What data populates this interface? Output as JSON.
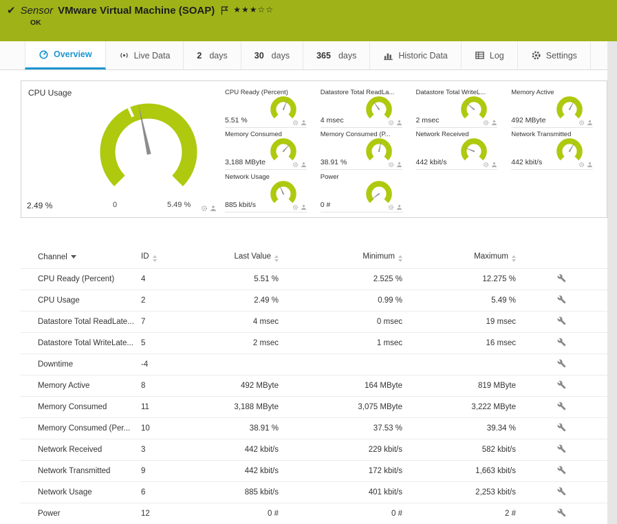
{
  "colors": {
    "brand_green": "#9fb318",
    "gauge_green": "#aec90e",
    "accent_blue": "#1c95d2"
  },
  "header": {
    "kind_label": "Sensor",
    "title": "VMware Virtual Machine (SOAP)",
    "status_text": "OK",
    "rating": {
      "filled": 3,
      "total": 5,
      "stars_text": "★★★☆☆"
    }
  },
  "tabs": {
    "overview": {
      "label": "Overview"
    },
    "live_data": {
      "label": "Live Data"
    },
    "days2": {
      "number": "2",
      "label": "days"
    },
    "days30": {
      "number": "30",
      "label": "days"
    },
    "days365": {
      "number": "365",
      "label": "days"
    },
    "historic": {
      "label": "Historic Data"
    },
    "log": {
      "label": "Log"
    },
    "settings": {
      "label": "Settings"
    }
  },
  "gauges": {
    "main": {
      "title": "CPU Usage",
      "value": "2.49 %",
      "min_label": "0",
      "max_label": "5.49 %",
      "needle_angle": -12
    },
    "small": [
      {
        "title": "CPU Ready (Percent)",
        "value": "5.51 %",
        "needle_angle": 22
      },
      {
        "title": "Datastore Total ReadLa...",
        "value": "4 msec",
        "needle_angle": -35
      },
      {
        "title": "Datastore Total WriteL...",
        "value": "2 msec",
        "needle_angle": -50
      },
      {
        "title": "Memory Active",
        "value": "492 MByte",
        "needle_angle": 28
      },
      {
        "title": "Memory Consumed",
        "value": "3,188 MByte",
        "needle_angle": 42
      },
      {
        "title": "Memory Consumed (P...",
        "value": "38.91 %",
        "needle_angle": 12
      },
      {
        "title": "Network Received",
        "value": "442 kbit/s",
        "needle_angle": -68
      },
      {
        "title": "Network Transmitted",
        "value": "442 kbit/s",
        "needle_angle": 30
      },
      {
        "title": "Network Usage",
        "value": "885 kbit/s",
        "needle_angle": -24
      },
      {
        "title": "Power",
        "value": "0 #",
        "needle_angle": -126
      }
    ]
  },
  "table": {
    "headers": {
      "channel": "Channel",
      "id": "ID",
      "last": "Last Value",
      "min": "Minimum",
      "max": "Maximum"
    },
    "rows": [
      {
        "channel": "CPU Ready (Percent)",
        "id": "4",
        "last": "5.51 %",
        "min": "2.525 %",
        "max": "12.275 %"
      },
      {
        "channel": "CPU Usage",
        "id": "2",
        "last": "2.49 %",
        "min": "0.99 %",
        "max": "5.49 %"
      },
      {
        "channel": "Datastore Total ReadLate...",
        "id": "7",
        "last": "4 msec",
        "min": "0 msec",
        "max": "19 msec"
      },
      {
        "channel": "Datastore Total WriteLate...",
        "id": "5",
        "last": "2 msec",
        "min": "1 msec",
        "max": "16 msec"
      },
      {
        "channel": "Downtime",
        "id": "-4",
        "last": "",
        "min": "",
        "max": ""
      },
      {
        "channel": "Memory Active",
        "id": "8",
        "last": "492 MByte",
        "min": "164 MByte",
        "max": "819 MByte"
      },
      {
        "channel": "Memory Consumed",
        "id": "11",
        "last": "3,188 MByte",
        "min": "3,075 MByte",
        "max": "3,222 MByte"
      },
      {
        "channel": "Memory Consumed (Per...",
        "id": "10",
        "last": "38.91 %",
        "min": "37.53 %",
        "max": "39.34 %"
      },
      {
        "channel": "Network Received",
        "id": "3",
        "last": "442 kbit/s",
        "min": "229 kbit/s",
        "max": "582 kbit/s"
      },
      {
        "channel": "Network Transmitted",
        "id": "9",
        "last": "442 kbit/s",
        "min": "172 kbit/s",
        "max": "1,663 kbit/s"
      },
      {
        "channel": "Network Usage",
        "id": "6",
        "last": "885 kbit/s",
        "min": "401 kbit/s",
        "max": "2,253 kbit/s"
      },
      {
        "channel": "Power",
        "id": "12",
        "last": "0 #",
        "min": "0 #",
        "max": "2 #"
      }
    ]
  }
}
